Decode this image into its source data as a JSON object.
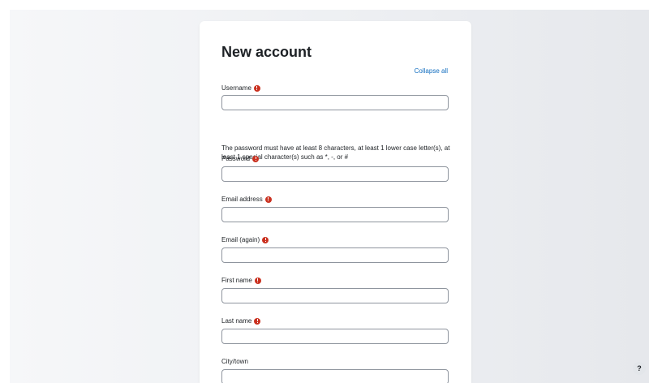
{
  "form": {
    "title": "New account",
    "collapse_all": "Collapse all",
    "password_policy": "The password must have at least 8 characters, at least 1 lower case letter(s), at least 1 special character(s) such as *, -, or #",
    "fields": {
      "username": {
        "label": "Username",
        "value": "",
        "required": true
      },
      "password": {
        "label": "Password",
        "value": "",
        "required": true
      },
      "email": {
        "label": "Email address",
        "value": "",
        "required": true
      },
      "email_again": {
        "label": "Email (again)",
        "value": "",
        "required": true
      },
      "first_name": {
        "label": "First name",
        "value": "",
        "required": true
      },
      "last_name": {
        "label": "Last name",
        "value": "",
        "required": true
      },
      "city": {
        "label": "City/town",
        "value": "",
        "required": false
      }
    }
  },
  "help": {
    "label": "?"
  },
  "icons": {
    "required": "exclamation-circle-icon",
    "help": "question-mark-icon"
  },
  "colors": {
    "link": "#0f6cbf",
    "required": "#ca3120",
    "text": "#1d2125",
    "input_border": "#8f959e"
  }
}
